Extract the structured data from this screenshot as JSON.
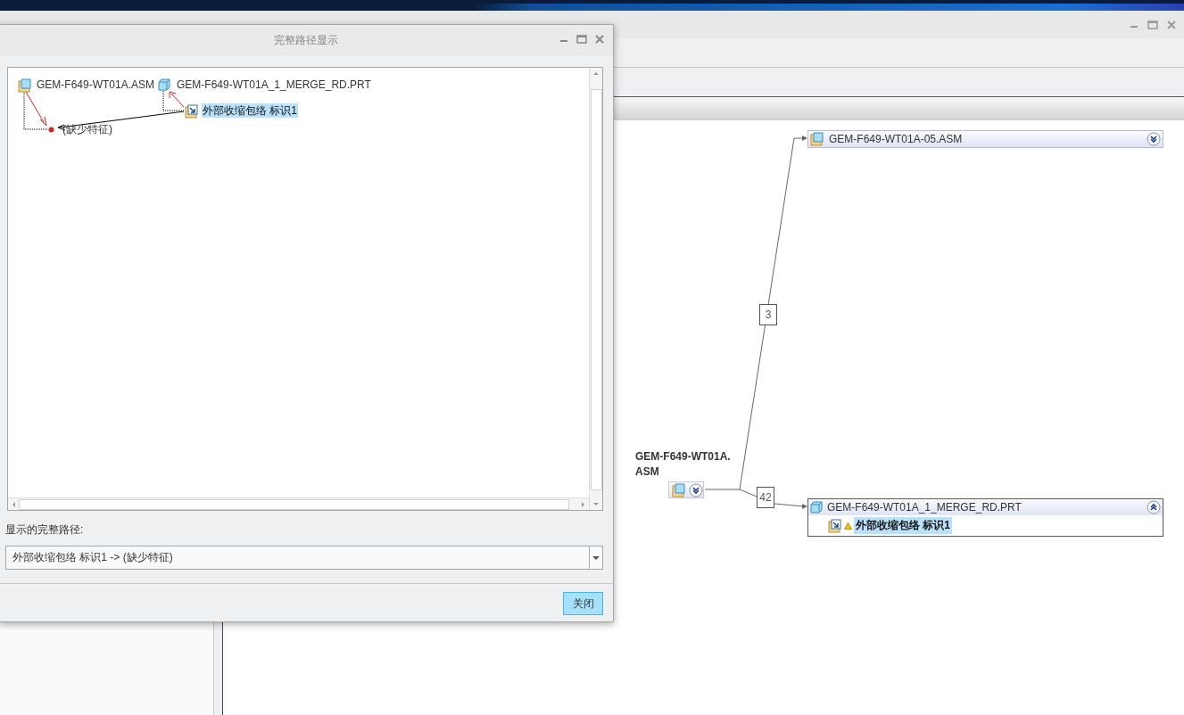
{
  "reference_viewer": {
    "canvas": {
      "root": {
        "label": "GEM-F649-WT01A.ASM",
        "expanded": false
      },
      "nodes": [
        {
          "kind": "assembly",
          "label": "GEM-F649-WT01A-05.ASM",
          "link_count": "3",
          "expanded": false,
          "selected": false
        },
        {
          "kind": "part",
          "label": "GEM-F649-WT01A_1_MERGE_RD.PRT",
          "link_count": "42",
          "expanded": true,
          "selected": true,
          "children": [
            {
              "kind": "feature",
              "label": "外部收缩包络 标识1",
              "warning": true,
              "selected": true
            }
          ]
        }
      ]
    }
  },
  "dialog": {
    "title": "完整路径显示",
    "tree": [
      {
        "kind": "assembly",
        "label": "GEM-F649-WT01A.ASM",
        "selected": false
      },
      {
        "kind": "part",
        "label": "GEM-F649-WT01A_1_MERGE_RD.PRT",
        "selected": false
      },
      {
        "kind": "feature",
        "label": "外部收缩包络 标识1",
        "selected": true
      },
      {
        "kind": "missing",
        "label": "(缺少特征)",
        "selected": false
      }
    ],
    "path_label": "显示的完整路径:",
    "path_value": "外部收缩包络 标识1 -> (缺少特征)",
    "buttons": [
      {
        "label": "关闭",
        "focused": true
      }
    ]
  }
}
